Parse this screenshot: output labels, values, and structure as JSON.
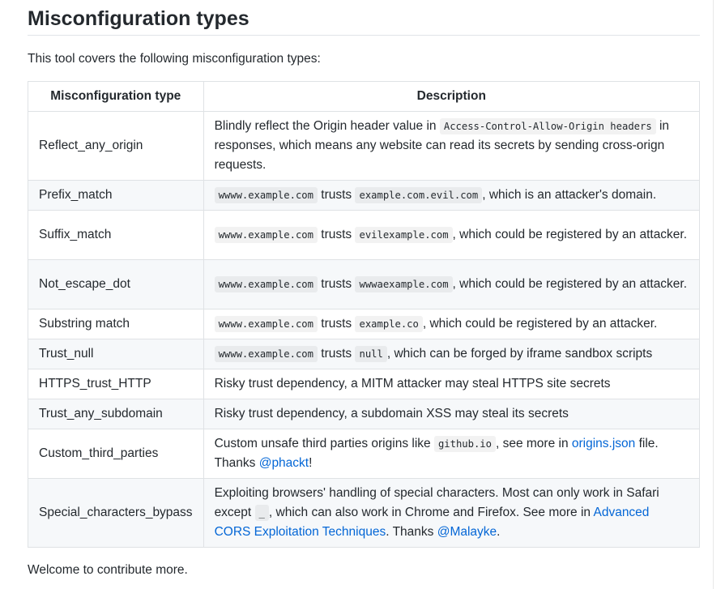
{
  "heading": "Misconfiguration types",
  "intro": "This tool covers the following misconfiguration types:",
  "table": {
    "col_type": "Misconfiguration type",
    "col_desc": "Description",
    "rows": [
      {
        "type": "Reflect_any_origin",
        "d1": "Blindly reflect the Origin header value in ",
        "c1": "Access-Control-Allow-Origin headers",
        "d2": " in responses, which means any website can read its secrets by sending cross-orign requests."
      },
      {
        "type": "Prefix_match",
        "c1": "wwww.example.com",
        "d1": " trusts ",
        "c2": "example.com.evil.com",
        "d2": ", which is an attacker's domain."
      },
      {
        "type": "Suffix_match",
        "c1": "wwww.example.com",
        "d1": " trusts ",
        "c2": "evilexample.com",
        "d2": ", which could be registered by an attacker."
      },
      {
        "type": "Not_escape_dot",
        "c1": "wwww.example.com",
        "d1": " trusts ",
        "c2": "wwwaexample.com",
        "d2": ", which could be registered by an attacker."
      },
      {
        "type": "Substring match",
        "c1": "wwww.example.com",
        "d1": " trusts ",
        "c2": "example.co",
        "d2": ", which could be registered by an attacker."
      },
      {
        "type": "Trust_null",
        "c1": "wwww.example.com",
        "d1": " trusts ",
        "c2": "null",
        "d2": ", which can be forged by iframe sandbox scripts"
      },
      {
        "type": "HTTPS_trust_HTTP",
        "d1": "Risky trust dependency, a MITM attacker may steal HTTPS site secrets"
      },
      {
        "type": "Trust_any_subdomain",
        "d1": "Risky trust dependency, a subdomain XSS may steal its secrets"
      },
      {
        "type": "Custom_third_parties",
        "d1": "Custom unsafe third parties origins like ",
        "c1": "github.io",
        "d2": ", see more in ",
        "link1": "origins.json",
        "d3": " file. Thanks ",
        "link2": "@phackt",
        "d4": "!"
      },
      {
        "type": "Special_characters_bypass",
        "d1": "Exploiting browsers' handling of special characters. Most can only work in Safari except ",
        "c1": "_",
        "d2": ", which can also work in Chrome and Firefox. See more in ",
        "link1": "Advanced CORS Exploitation Techniques",
        "d3": ". Thanks ",
        "link2": "@Malayke",
        "d4": "."
      }
    ]
  },
  "outro": "Welcome to contribute more.",
  "colors": {
    "link": "#0366d6",
    "row_alt": "#f6f8fa",
    "border": "#dfe2e5"
  }
}
